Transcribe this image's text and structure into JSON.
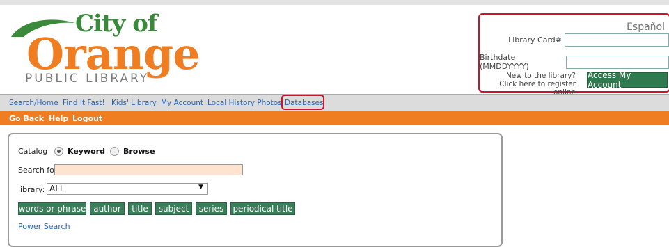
{
  "logo": {
    "city": "City of",
    "orange": "Orange",
    "public_library": "PUBLIC LIBRARY"
  },
  "login": {
    "language_link": "Español",
    "card_label": "Library Card#",
    "card_value": "",
    "birthdate_label": "Birthdate (MMDDYYYY)",
    "birthdate_value": "",
    "new_line1": "New to the library?",
    "new_line2": "Click here to register online",
    "access_button": "Access My Account"
  },
  "nav": {
    "items": [
      "Search/Home",
      "Find It Fast!",
      "Kids' Library",
      "My Account",
      "Local History Photos",
      "Databases"
    ]
  },
  "subnav": {
    "items": [
      "Go Back",
      "Help",
      "Logout"
    ]
  },
  "search": {
    "catalog_label": "Catalog",
    "keyword_label": "Keyword",
    "browse_label": "Browse",
    "mode_selected": "Keyword",
    "search_for_label": "Search for",
    "search_value": "",
    "library_label": "library:",
    "library_selected": "ALL",
    "buttons": [
      "words or phrase",
      "author",
      "title",
      "subject",
      "series",
      "periodical title"
    ],
    "power_search": "Power Search"
  },
  "colors": {
    "brand_orange": "#ef7d22",
    "brand_green": "#3b8a3b",
    "button_green": "#3a7e5a",
    "highlight_red": "#d0112b",
    "link_blue": "#2a66b8"
  }
}
